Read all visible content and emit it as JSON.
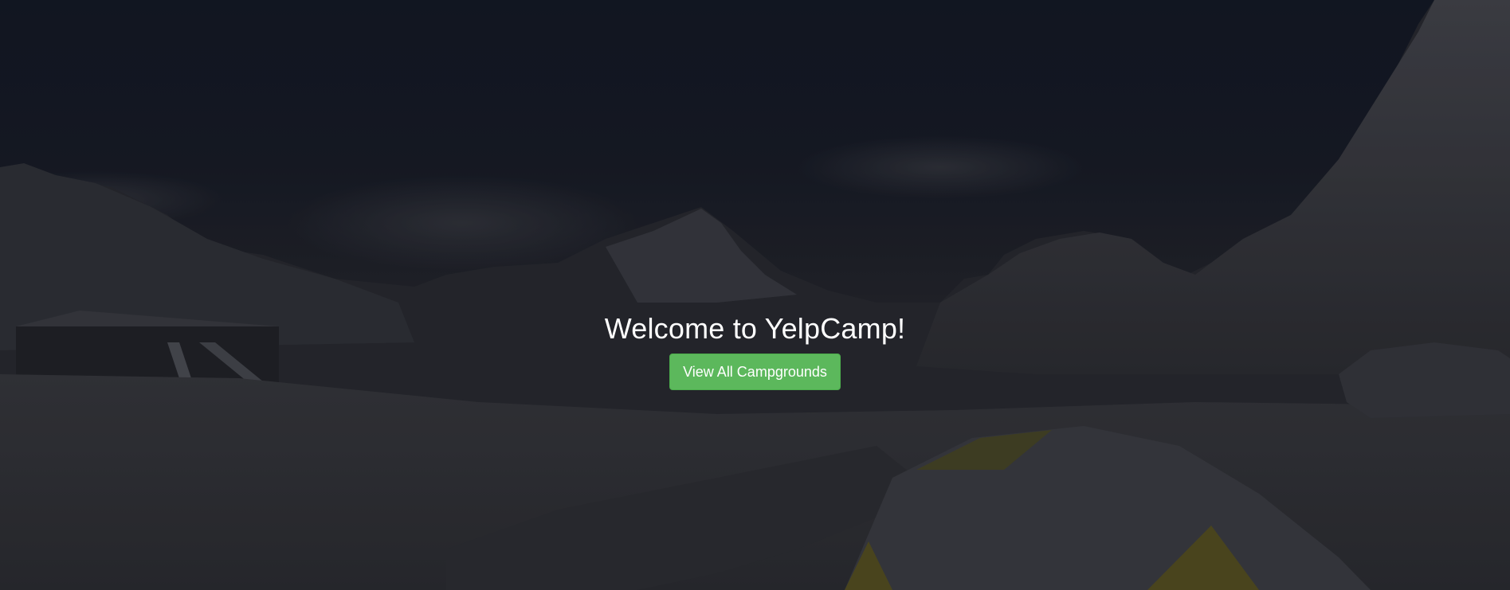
{
  "landing": {
    "heading": "Welcome to YelpCamp!",
    "cta_label": "View All Campgrounds"
  },
  "colors": {
    "cta_background": "#5cb85c",
    "heading_text": "#ffffff"
  }
}
